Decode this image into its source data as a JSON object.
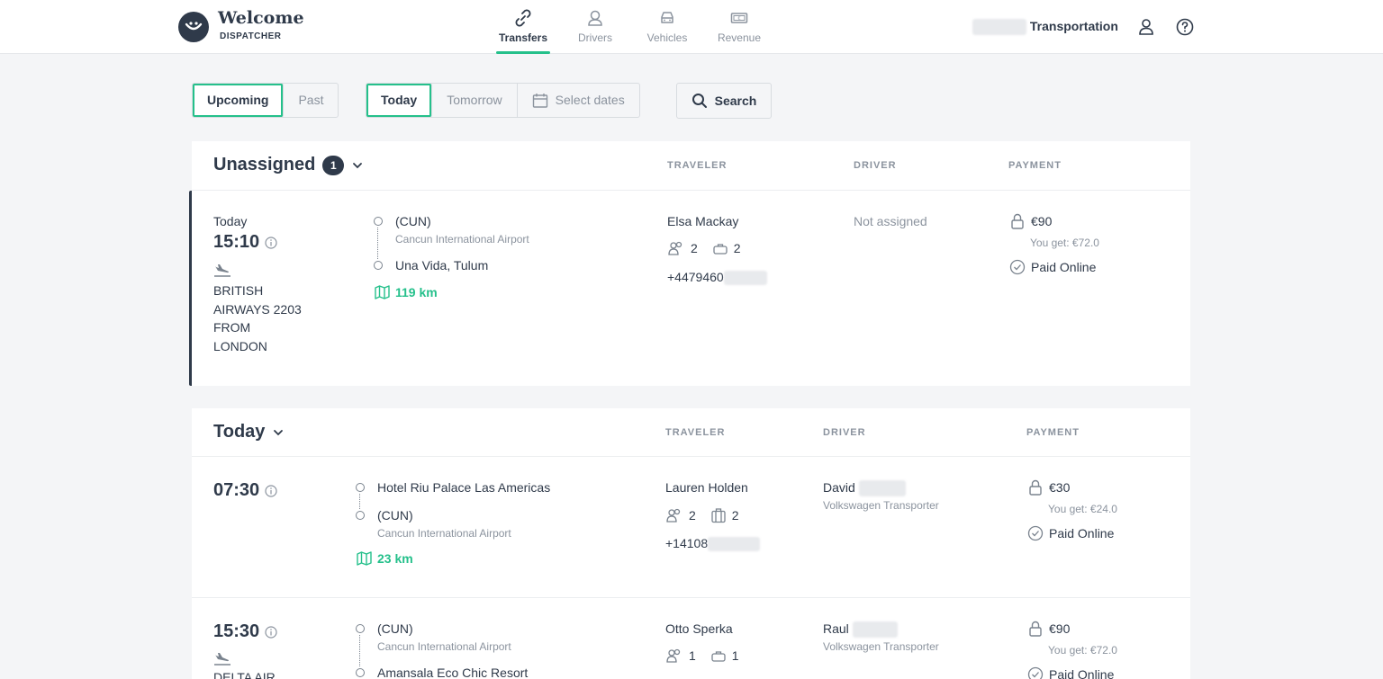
{
  "header": {
    "brand_title": "Welcome",
    "brand_subtitle": "DISPATCHER",
    "nav": [
      {
        "label": "Transfers",
        "icon": "link-icon",
        "active": true
      },
      {
        "label": "Drivers",
        "icon": "driver-icon",
        "active": false
      },
      {
        "label": "Vehicles",
        "icon": "car-icon",
        "active": false
      },
      {
        "label": "Revenue",
        "icon": "banknote-icon",
        "active": false
      }
    ],
    "company_name": "Transportation",
    "accent_color": "#25c08b"
  },
  "filters": {
    "period": [
      "Upcoming",
      "Past"
    ],
    "period_selected": "Upcoming",
    "day": [
      "Today",
      "Tomorrow"
    ],
    "day_selected": "Today",
    "select_dates": "Select dates",
    "search": "Search"
  },
  "columns": {
    "traveler": "TRAVELER",
    "driver": "DRIVER",
    "payment": "PAYMENT"
  },
  "unassigned": {
    "title": "Unassigned",
    "count": "1",
    "transfer": {
      "day": "Today",
      "time": "15:10",
      "flight": "BRITISH AIRWAYS 2203 FROM LONDON",
      "from_code": "(CUN)",
      "from_name": "Cancun International Airport",
      "to": "Una Vida, Tulum",
      "distance": "119 km",
      "traveler": "Elsa Mackay",
      "passengers": "2",
      "luggage": "2",
      "phone": "+4479460",
      "driver": "Not assigned",
      "price": "€90",
      "you_get": "You get: €72.0",
      "payment_status": "Paid Online"
    }
  },
  "today": {
    "title": "Today",
    "transfers": [
      {
        "time": "07:30",
        "from_name_main": "Hotel Riu Palace Las Americas",
        "to_code": "(CUN)",
        "to_name": "Cancun International Airport",
        "distance": "23 km",
        "traveler": "Lauren Holden",
        "passengers": "2",
        "luggage": "2",
        "phone": "+14108",
        "driver": "David",
        "vehicle": "Volkswagen Transporter",
        "price": "€30",
        "you_get": "You get: €24.0",
        "payment_status": "Paid Online"
      },
      {
        "time": "15:30",
        "flight": "DELTA AIR",
        "from_code": "(CUN)",
        "from_name": "Cancun International Airport",
        "to": "Amansala Eco Chic Resort",
        "traveler": "Otto Sperka",
        "passengers": "1",
        "luggage": "1",
        "driver": "Raul",
        "vehicle": "Volkswagen Transporter",
        "price": "€90",
        "you_get": "You get: €72.0",
        "payment_status": "Paid Online"
      }
    ]
  }
}
